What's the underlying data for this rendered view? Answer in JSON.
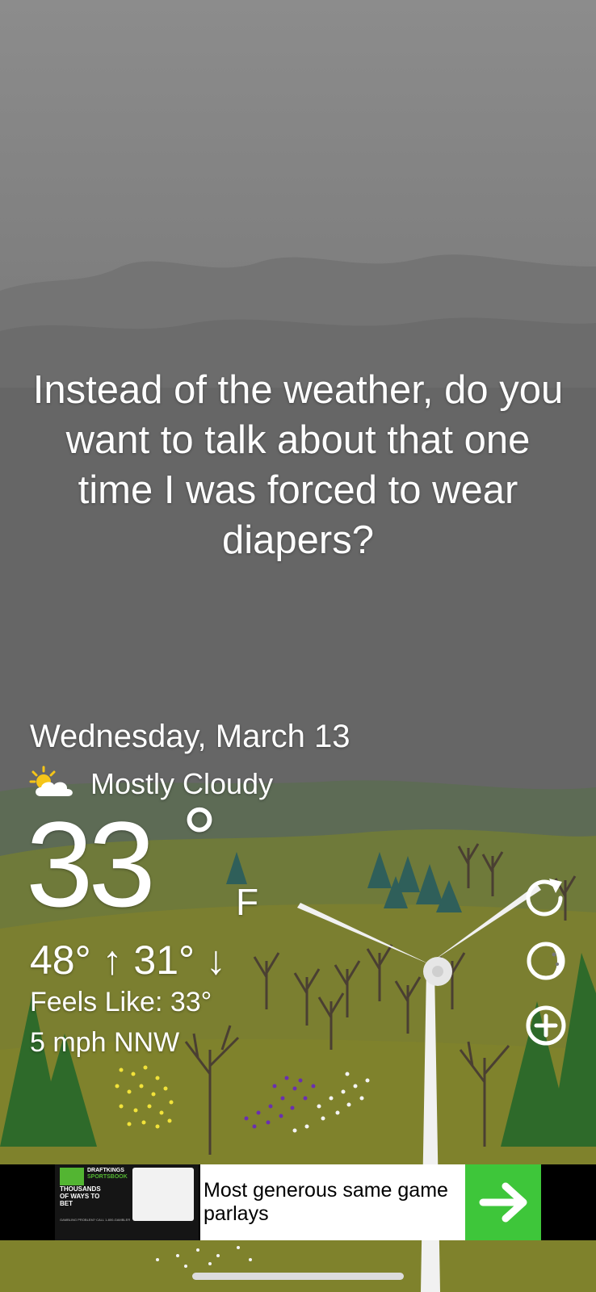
{
  "message": "Instead of the weather, do you want to talk about that one time I was forced to wear diapers?",
  "weather": {
    "date": "Wednesday, March 13",
    "condition": "Mostly Cloudy",
    "condition_icon": "partly-cloudy-icon",
    "temperature": "33",
    "degree_symbol": "°",
    "unit": "F",
    "hi_lo": "48° ↑ 31° ↓",
    "feels_like": "Feels Like: 33°",
    "wind": "5 mph NNW"
  },
  "side_buttons": [
    "refresh-icon",
    "moon-phase-icon",
    "add-location-icon"
  ],
  "ad": {
    "brand_top": "DRAFTKINGS",
    "brand_bottom": "SPORTSBOOK",
    "tagline": "THOUSANDS OF WAYS TO BET",
    "fine_print": "GAMBLING PROBLEM? CALL 1-800-GAMBLER",
    "copy": "Most generous same game parlays",
    "cta_icon": "arrow-right-icon"
  },
  "colors": {
    "sky": "#6a6a6a",
    "ground": "#7a7a32",
    "pine": "#2d5e2a",
    "ad_green": "#3ec63a"
  }
}
